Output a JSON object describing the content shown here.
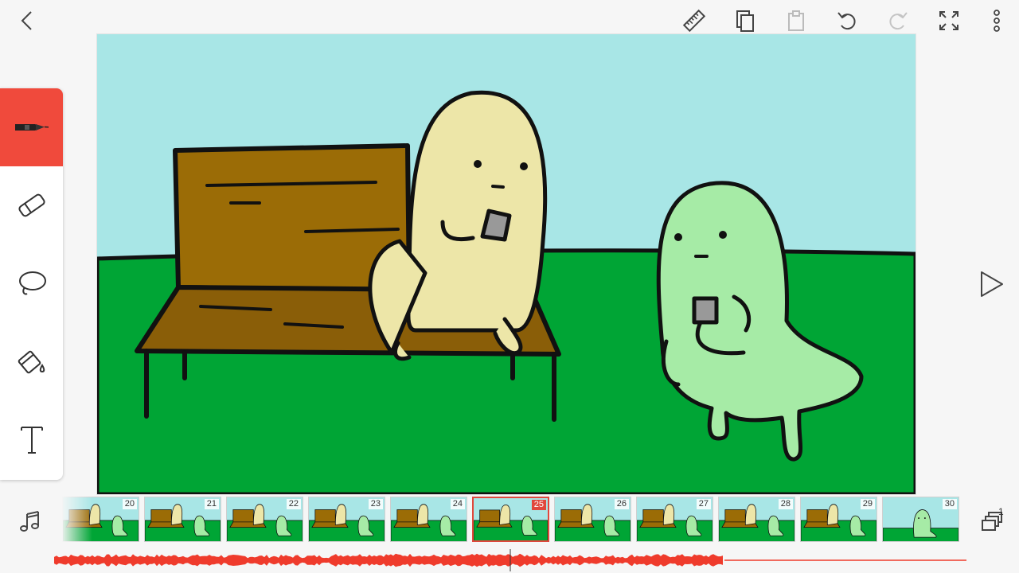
{
  "toolbar": {
    "icons": [
      "back-arrow-icon",
      "ruler-icon",
      "copy-icon",
      "paste-icon",
      "undo-icon",
      "redo-icon",
      "fullscreen-icon",
      "more-vertical-icon"
    ]
  },
  "tools": [
    {
      "name": "pen",
      "icon": "pen-icon",
      "active": true
    },
    {
      "name": "eraser",
      "icon": "eraser-icon",
      "active": false
    },
    {
      "name": "lasso",
      "icon": "lasso-icon",
      "active": false
    },
    {
      "name": "fill",
      "icon": "paint-bucket-icon",
      "active": false
    },
    {
      "name": "text",
      "icon": "text-icon",
      "active": false
    }
  ],
  "colors": {
    "accent": "#f04a3c",
    "sky": "#a8e6e6",
    "grass": "#00a535",
    "bench": "#9b6c06",
    "yellow_character": "#ede6a8",
    "green_character": "#a6eba6",
    "waveform": "#ef3b2c"
  },
  "timeline": {
    "current_frame": "25",
    "frames": [
      "20",
      "21",
      "22",
      "23",
      "24",
      "25",
      "26",
      "27",
      "28",
      "29",
      "30"
    ]
  },
  "layers": {
    "count": "1"
  },
  "audio": {
    "playback_position": 0.5
  }
}
